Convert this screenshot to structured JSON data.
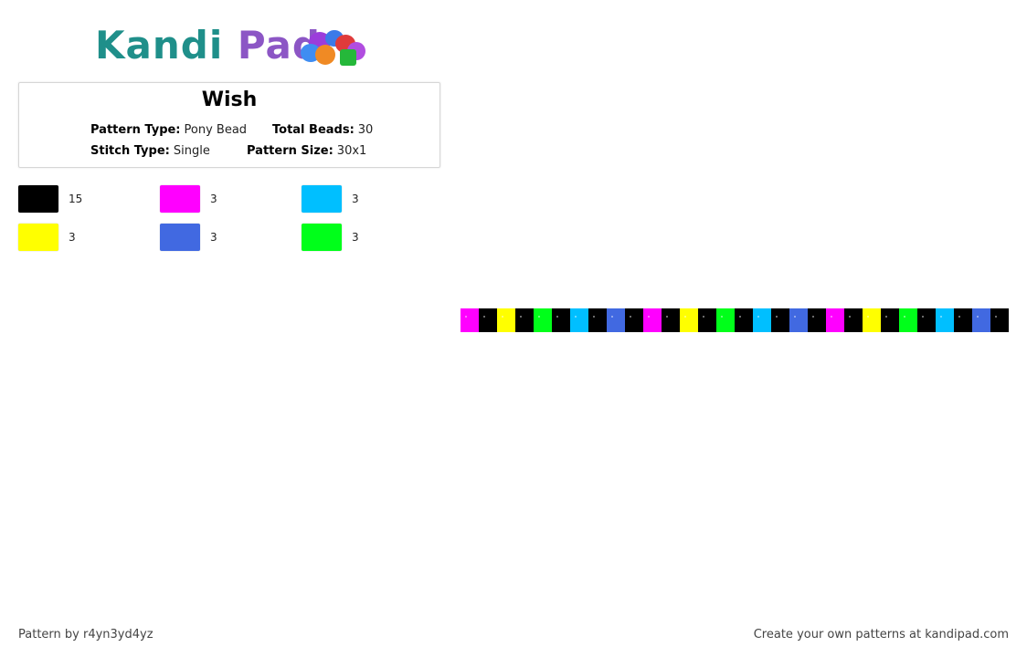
{
  "logo": {
    "part1": "Kandi",
    "part2": "Pad"
  },
  "pattern": {
    "title": "Wish",
    "type_label": "Pattern Type:",
    "type_value": "Pony Bead",
    "beads_label": "Total Beads:",
    "beads_value": "30",
    "stitch_label": "Stitch Type:",
    "stitch_value": "Single",
    "size_label": "Pattern Size:",
    "size_value": "30x1"
  },
  "legend": [
    {
      "color": "#000000",
      "count": "15"
    },
    {
      "color": "#ff00ff",
      "count": "3"
    },
    {
      "color": "#00bfff",
      "count": "3"
    },
    {
      "color": "#ffff00",
      "count": "3"
    },
    {
      "color": "#4169e1",
      "count": "3"
    },
    {
      "color": "#00ff1a",
      "count": "3"
    }
  ],
  "bead_strip": [
    "#ff00ff",
    "#000000",
    "#ffff00",
    "#000000",
    "#00ff1a",
    "#000000",
    "#00bfff",
    "#000000",
    "#4169e1",
    "#000000",
    "#ff00ff",
    "#000000",
    "#ffff00",
    "#000000",
    "#00ff1a",
    "#000000",
    "#00bfff",
    "#000000",
    "#4169e1",
    "#000000",
    "#ff00ff",
    "#000000",
    "#ffff00",
    "#000000",
    "#00ff1a",
    "#000000",
    "#00bfff",
    "#000000",
    "#4169e1",
    "#000000"
  ],
  "footer": {
    "left": "Pattern by r4yn3yd4yz",
    "right": "Create your own patterns at kandipad.com"
  }
}
